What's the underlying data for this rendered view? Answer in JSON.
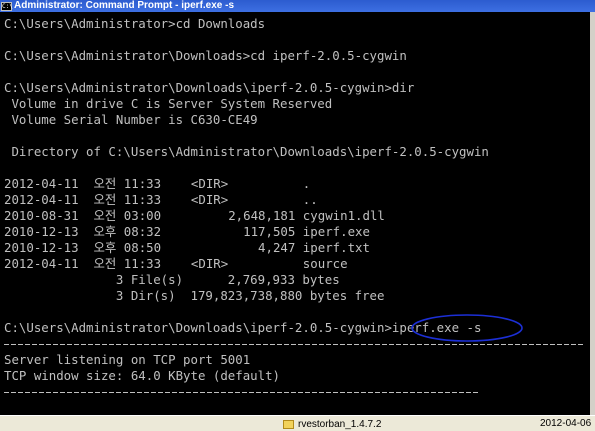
{
  "window": {
    "title": "Administrator: Command Prompt - iperf.exe  -s",
    "icon": "cmd-icon",
    "icon_label": "C:\\"
  },
  "console": {
    "lines": [
      "C:\\Users\\Administrator>cd Downloads",
      "",
      "C:\\Users\\Administrator\\Downloads>cd iperf-2.0.5-cygwin",
      "",
      "C:\\Users\\Administrator\\Downloads\\iperf-2.0.5-cygwin>dir",
      " Volume in drive C is Server System Reserved",
      " Volume Serial Number is C630-CE49",
      "",
      " Directory of C:\\Users\\Administrator\\Downloads\\iperf-2.0.5-cygwin",
      "",
      "2012-04-11  오전 11:33    <DIR>          .",
      "2012-04-11  오전 11:33    <DIR>          ..",
      "2010-08-31  오전 03:00         2,648,181 cygwin1.dll",
      "2010-12-13  오후 08:32           117,505 iperf.exe",
      "2010-12-13  오후 08:50             4,247 iperf.txt",
      "2012-04-11  오전 11:33    <DIR>          source",
      "               3 File(s)      2,769,933 bytes",
      "               3 Dir(s)  179,823,738,880 bytes free",
      "",
      "C:\\Users\\Administrator\\Downloads\\iperf-2.0.5-cygwin>iperf.exe -s",
      "",
      "Server listening on TCP port 5001",
      "TCP window size: 64.0 KByte (default)"
    ]
  },
  "taskbar": {
    "item_label": "rvestorban_1.4.7.2",
    "date": "2012-04-06"
  },
  "colors": {
    "console_bg": "#000000",
    "console_text": "#c0c0c0",
    "titlebar": "#3566d8",
    "annotation": "#1c2fd6"
  }
}
